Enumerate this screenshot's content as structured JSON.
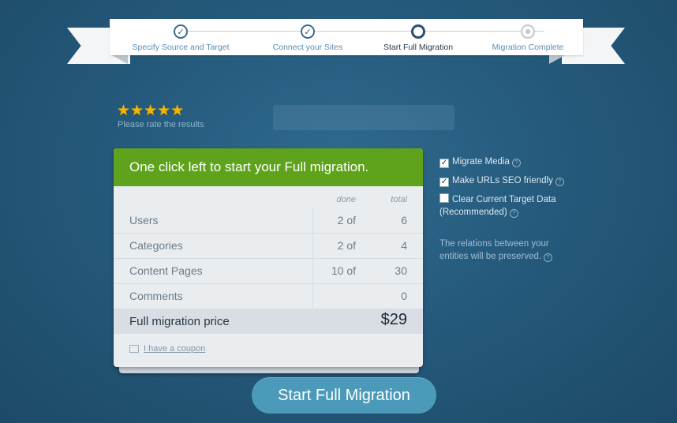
{
  "steps": [
    {
      "label": "Specify Source and Target",
      "state": "done"
    },
    {
      "label": "Connect your Sites",
      "state": "done"
    },
    {
      "label": "Start Full Migration",
      "state": "current"
    },
    {
      "label": "Migration Complete",
      "state": "future"
    }
  ],
  "rating": {
    "stars": "★★★★★",
    "prompt": "Please rate the results"
  },
  "card": {
    "header": "One click left to start your Full migration.",
    "col_done": "done",
    "col_total": "total",
    "rows": [
      {
        "label": "Users",
        "done": "2 of",
        "total": "6"
      },
      {
        "label": "Categories",
        "done": "2 of",
        "total": "4"
      },
      {
        "label": "Content Pages",
        "done": "10 of",
        "total": "30"
      },
      {
        "label": "Comments",
        "done": "",
        "total": "0"
      }
    ],
    "price_label": "Full migration price",
    "price_value": "$29",
    "coupon": "I have a coupon"
  },
  "options": [
    {
      "label": "Migrate Media",
      "checked": true
    },
    {
      "label": "Make URLs SEO friendly",
      "checked": true
    },
    {
      "label": "Clear Current Target Data (Recommended)",
      "checked": false
    }
  ],
  "note": "The relations between your entities will be preserved.",
  "cta": "Start Full Migration"
}
